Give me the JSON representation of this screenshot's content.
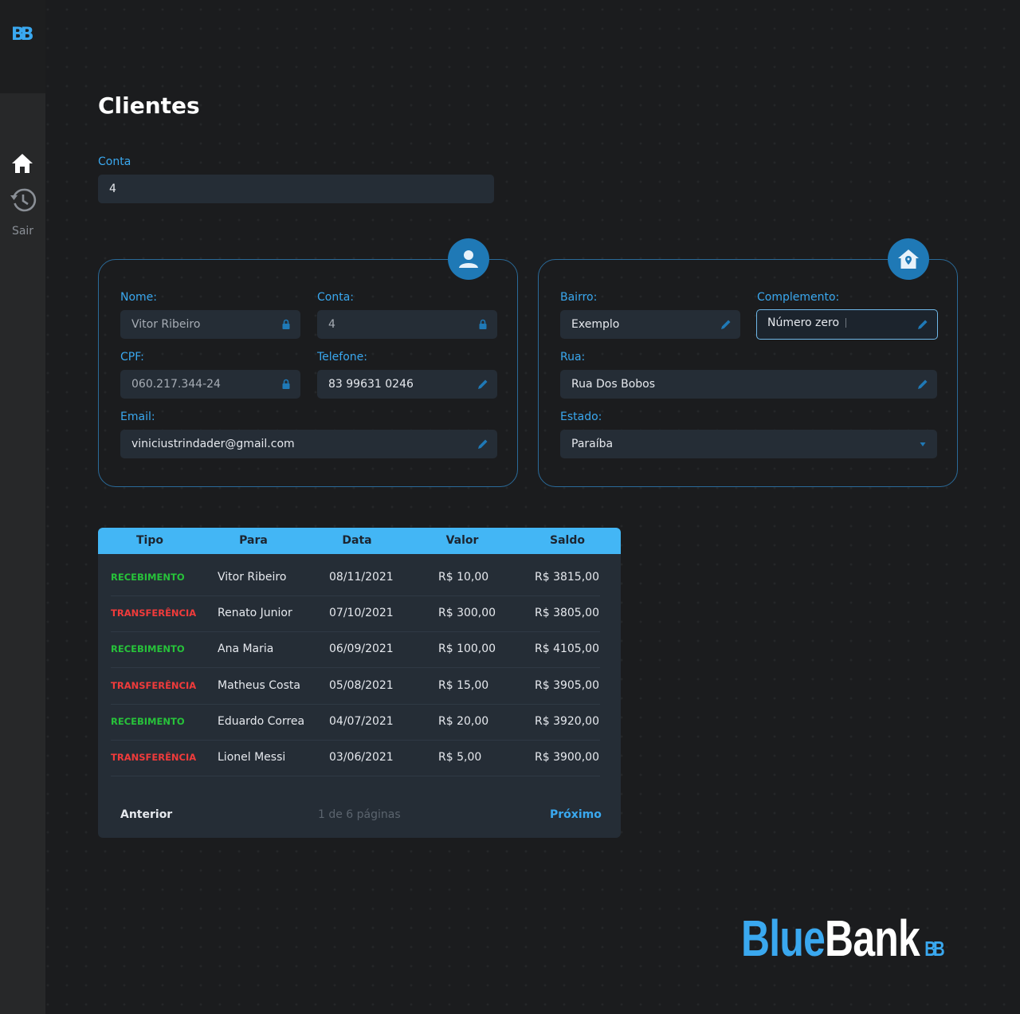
{
  "sidebar": {
    "logo_text": "BB",
    "exit_label": "Sair"
  },
  "page": {
    "title": "Clientes",
    "account_label": "Conta",
    "account_value": "4"
  },
  "personal_card": {
    "icon": "user-icon",
    "name_label": "Nome:",
    "name_value": "Vitor Ribeiro",
    "account_label": "Conta:",
    "account_value": "4",
    "cpf_label": "CPF:",
    "cpf_value": "060.217.344-24",
    "phone_label": "Telefone:",
    "phone_value": "83 99631 0246",
    "email_label": "Email:",
    "email_value": "viniciustrindader@gmail.com"
  },
  "address_card": {
    "icon": "home-location-icon",
    "district_label": "Bairro:",
    "district_value": "Exemplo",
    "complement_label": "Complemento:",
    "complement_value": "Número zero",
    "street_label": "Rua:",
    "street_value": "Rua Dos Bobos",
    "state_label": "Estado:",
    "state_value": "Paraíba"
  },
  "table": {
    "headers": [
      "Tipo",
      "Para",
      "Data",
      "Valor",
      "Saldo"
    ],
    "rows": [
      {
        "tipo": "RECEBIMENTO",
        "para": "Vitor Ribeiro",
        "data": "08/11/2021",
        "valor": "R$ 10,00",
        "saldo": "R$ 3815,00"
      },
      {
        "tipo": "TRANSFERÊNCIA",
        "para": "Renato Junior",
        "data": "07/10/2021",
        "valor": "R$ 300,00",
        "saldo": "R$ 3805,00"
      },
      {
        "tipo": "RECEBIMENTO",
        "para": "Ana Maria",
        "data": "06/09/2021",
        "valor": "R$ 100,00",
        "saldo": "R$ 4105,00"
      },
      {
        "tipo": "TRANSFERÊNCIA",
        "para": "Matheus Costa",
        "data": "05/08/2021",
        "valor": "R$ 15,00",
        "saldo": "R$ 3905,00"
      },
      {
        "tipo": "RECEBIMENTO",
        "para": "Eduardo Correa",
        "data": "04/07/2021",
        "valor": "R$ 20,00",
        "saldo": "R$ 3920,00"
      },
      {
        "tipo": "TRANSFERÊNCIA",
        "para": "Lionel Messi",
        "data": "03/06/2021",
        "valor": "R$ 5,00",
        "saldo": "R$ 3900,00"
      }
    ],
    "prev_label": "Anterior",
    "page_info": "1 de 6 páginas",
    "next_label": "Próximo"
  },
  "brand": {
    "part1": "Blue",
    "part2": "Bank",
    "mark": "BB"
  },
  "colors": {
    "accent": "#3aa8ef",
    "income": "#27c23a",
    "transfer": "#f03b3b",
    "header_bg": "#43b6f5"
  }
}
